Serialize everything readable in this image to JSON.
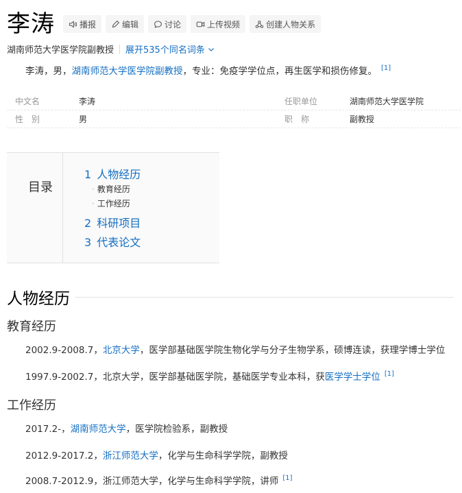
{
  "header": {
    "title": "李涛",
    "tools": [
      {
        "icon": "speaker-icon",
        "label": "播报"
      },
      {
        "icon": "pencil-icon",
        "label": "编辑"
      },
      {
        "icon": "chat-bubble-icon",
        "label": "讨论"
      },
      {
        "icon": "video-icon",
        "label": "上传视频"
      },
      {
        "icon": "people-network-icon",
        "label": "创建人物关系"
      }
    ],
    "subtitle": "湖南师范大学医学院副教授",
    "expand_label": "展开535个同名词条"
  },
  "summary": {
    "text1": "李涛，男，",
    "link": "湖南师范大学医学院副教授",
    "text2": "，专业：免疫学学位点，再生医学和损伤修复。",
    "ref": "[1]"
  },
  "basic_info": [
    {
      "name": "中文名",
      "value": "李涛",
      "name2": "任职单位",
      "value2": "湖南师范大学医学院"
    },
    {
      "name": "性　别",
      "value": "男",
      "name2": "职　称",
      "value2": "副教授"
    }
  ],
  "catalog": {
    "label": "目录",
    "items": [
      {
        "num": "1",
        "label": "人物经历"
      },
      {
        "label": "教育经历"
      },
      {
        "label": "工作经历"
      },
      {
        "num": "2",
        "label": "科研项目"
      },
      {
        "num": "3",
        "label": "代表论文"
      }
    ]
  },
  "section1": {
    "title": "人物经历",
    "edu_title": "教育经历",
    "edu": [
      {
        "t1": "2002.9-2008.7，",
        "link": "北京大学",
        "t2": "，医学部基础医学院生物化学与分子生物学系，硕博连读，获理学博士学位"
      },
      {
        "t1": "1997.9-2002.7，北京大学，医学部基础医学院，基础医学专业本科，获",
        "link": "医学学士学位",
        "ref": "[1]"
      }
    ],
    "work_title": "工作经历",
    "work": [
      {
        "t1": "2017.2-，",
        "link": "湖南师范大学",
        "t2": "，医学院检验系，副教授"
      },
      {
        "t1": "2012.9-2017.2，",
        "link": "浙江师范大学",
        "t2": "，化学与生命科学学院，副教授"
      },
      {
        "t1": "2008.7-2012.9，浙江师范大学，化学与生命科学学院，讲师",
        "ref": "[1]"
      }
    ]
  },
  "colors": {
    "link": "#136ec2",
    "tool_bg": "#f5f5f5",
    "catalog_bg": "#fafafa"
  }
}
